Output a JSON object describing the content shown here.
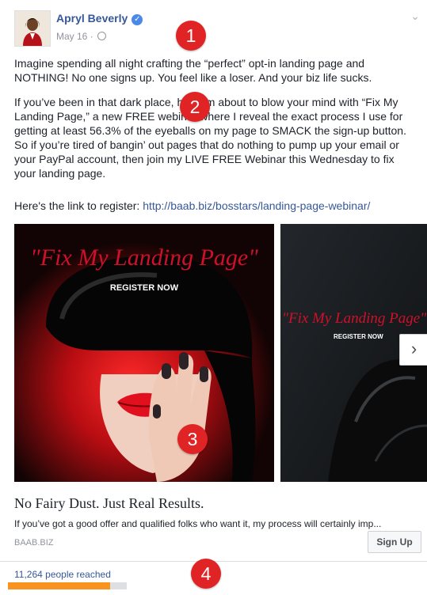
{
  "post": {
    "author": "Apryl Beverly",
    "date": "May 16",
    "date_sep": "·",
    "paragraphs": [
      "Imagine spending all night crafting the “perfect” opt-in landing page and NOTHING! No one signs up. You feel like a loser. And your biz life sucks.",
      "If you’ve been in that dark place, hey, I’m about to blow your mind with “Fix My Landing Page,” a new FREE webinar where I reveal the exact process I use for getting at least 56.3% of the eyeballs on my page to SMACK the sign-up button. So if you’re tired of bangin’ out pages that do nothing to pump up your email or your PayPal account, then join my LIVE FREE Webinar this Wednesday to fix your landing page."
    ],
    "link_intro": "Here's the link to register:",
    "link_url": "http://baab.biz/bosstars/landing-page-webinar/"
  },
  "carousel": {
    "card1": {
      "title": "\"Fix My Landing Page\"",
      "cta": "REGISTER NOW"
    },
    "card2": {
      "title": "\"Fix My Landing Page\"",
      "cta": "REGISTER NOW"
    },
    "next_glyph": "›"
  },
  "link_preview": {
    "headline": "No Fairy Dust. Just Real Results.",
    "description": "If you’ve got a good offer and qualified folks who want it, my process will certainly imp...",
    "domain": "BAAB.BIZ",
    "button": "Sign Up"
  },
  "insights": {
    "reached_text": "11,264 people reached",
    "reach_progress": 0.86
  },
  "annotations": [
    "1",
    "2",
    "3",
    "4"
  ],
  "colors": {
    "link": "#365899",
    "badge_red": "#e02425",
    "reach_orange": "#f7931e",
    "poster_red": "#d0102a"
  }
}
